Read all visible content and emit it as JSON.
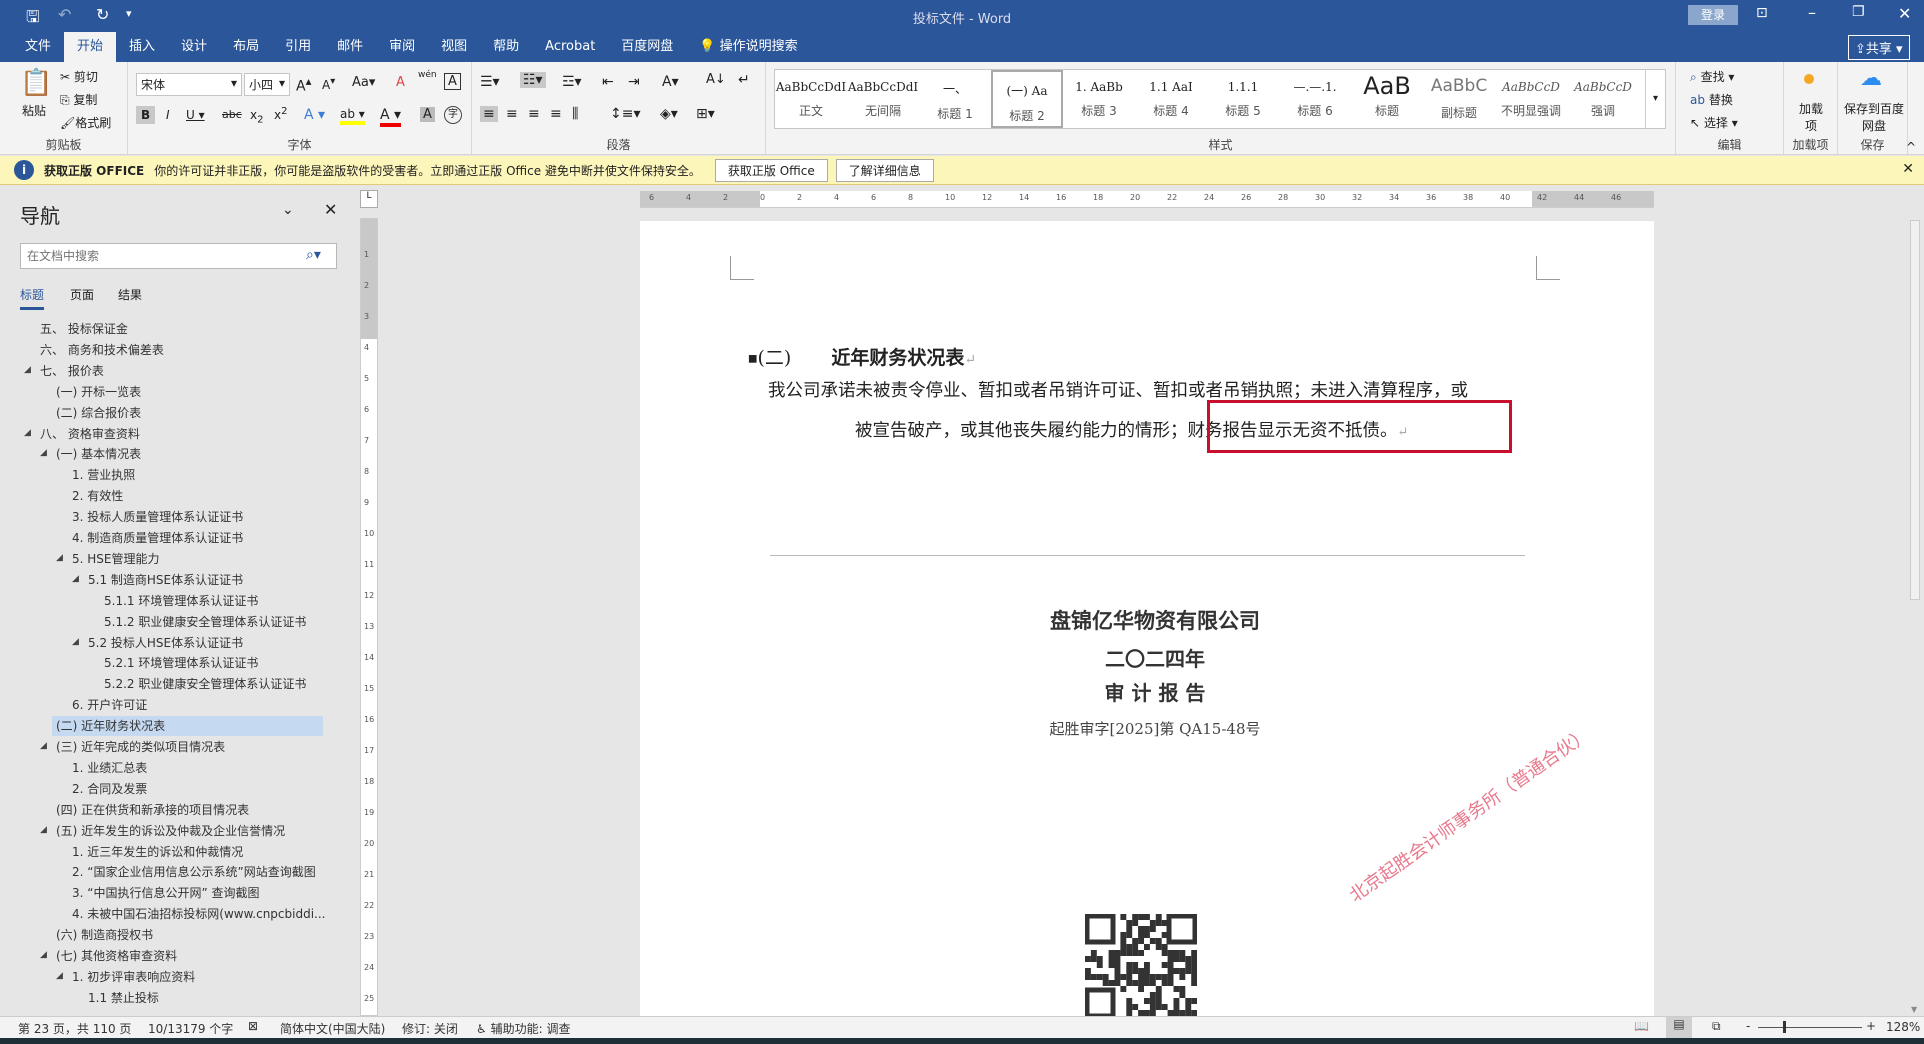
{
  "titlebar": {
    "title": "投标文件 - Word",
    "login": "登录",
    "icons": [
      "save-icon",
      "undo-icon",
      "redo-icon",
      "customize-icon"
    ]
  },
  "tabs": [
    "文件",
    "开始",
    "插入",
    "设计",
    "布局",
    "引用",
    "邮件",
    "审阅",
    "视图",
    "帮助",
    "Acrobat",
    "百度网盘"
  ],
  "tell_me": "操作说明搜索",
  "share": "共享",
  "ribbon": {
    "clipboard": {
      "label": "剪贴板",
      "paste": "粘贴",
      "cut": "剪切",
      "copy": "复制",
      "format_painter": "格式刷"
    },
    "font": {
      "label": "字体",
      "font_name": "宋体",
      "font_size": "小四",
      "change_case": "Aa",
      "pinyin": "wén"
    },
    "paragraph": {
      "label": "段落"
    },
    "styles": {
      "label": "样式",
      "items": [
        {
          "preview": "AaBbCcDdI",
          "name": "正文"
        },
        {
          "preview": "AaBbCcDdI",
          "name": "无间隔"
        },
        {
          "preview": "一、",
          "name": "标题 1"
        },
        {
          "preview": "(一)  Aa",
          "name": "标题 2"
        },
        {
          "preview": "1. AaBb",
          "name": "标题 3"
        },
        {
          "preview": "1.1  AaI",
          "name": "标题 4"
        },
        {
          "preview": "1.1.1",
          "name": "标题 5"
        },
        {
          "preview": "—.—.1.",
          "name": "标题 6"
        },
        {
          "preview": "AaB",
          "name": "标题"
        },
        {
          "preview": "AaBbC",
          "name": "副标题"
        },
        {
          "preview": "AaBbCcD",
          "name": "不明显强调"
        },
        {
          "preview": "AaBbCcD",
          "name": "强调"
        }
      ],
      "selected": "标题 2"
    },
    "editing": {
      "label": "编辑",
      "find": "查找",
      "replace": "替换",
      "select": "选择"
    },
    "addins": {
      "label": "加载项",
      "button": "加载项"
    },
    "save": {
      "label": "保存",
      "button": "保存到百度网盘"
    }
  },
  "message_bar": {
    "title": "获取正版 OFFICE",
    "text": "你的许可证并非正版，你可能是盗版软件的受害者。立即通过正版 Office 避免中断并使文件保持安全。",
    "btn1": "获取正版 Office",
    "btn2": "了解详细信息"
  },
  "nav": {
    "title": "导航",
    "search_placeholder": "在文档中搜索",
    "tabs": [
      "标题",
      "页面",
      "结果"
    ],
    "active_tab": "标题",
    "items": [
      {
        "text": "五、 投标保证金",
        "level": 1,
        "expand": false
      },
      {
        "text": "六、 商务和技术偏差表",
        "level": 1,
        "expand": false
      },
      {
        "text": "七、 报价表",
        "level": 1,
        "expand": true
      },
      {
        "text": "(一) 开标一览表",
        "level": 2,
        "expand": false
      },
      {
        "text": "(二) 综合报价表",
        "level": 2,
        "expand": false
      },
      {
        "text": "八、 资格审查资料",
        "level": 1,
        "expand": true
      },
      {
        "text": "(一) 基本情况表",
        "level": 2,
        "expand": true
      },
      {
        "text": "1. 营业执照",
        "level": 3,
        "expand": false
      },
      {
        "text": "2. 有效性",
        "level": 3,
        "expand": false
      },
      {
        "text": "3. 投标人质量管理体系认证证书",
        "level": 3,
        "expand": false
      },
      {
        "text": "4. 制造商质量管理体系认证证书",
        "level": 3,
        "expand": false
      },
      {
        "text": "5. HSE管理能力",
        "level": 3,
        "expand": true
      },
      {
        "text": "5.1 制造商HSE体系认证证书",
        "level": 4,
        "expand": true
      },
      {
        "text": "5.1.1 环境管理体系认证证书",
        "level": 5,
        "expand": false
      },
      {
        "text": "5.1.2 职业健康安全管理体系认证证书",
        "level": 5,
        "expand": false
      },
      {
        "text": "5.2 投标人HSE体系认证证书",
        "level": 4,
        "expand": true
      },
      {
        "text": "5.2.1 环境管理体系认证证书",
        "level": 5,
        "expand": false
      },
      {
        "text": "5.2.2 职业健康安全管理体系认证证书",
        "level": 5,
        "expand": false
      },
      {
        "text": "6. 开户许可证",
        "level": 3,
        "expand": false
      },
      {
        "text": "(二) 近年财务状况表",
        "level": 2,
        "expand": false,
        "selected": true
      },
      {
        "text": "(三) 近年完成的类似项目情况表",
        "level": 2,
        "expand": true
      },
      {
        "text": "1. 业绩汇总表",
        "level": 3,
        "expand": false
      },
      {
        "text": "2. 合同及发票",
        "level": 3,
        "expand": false
      },
      {
        "text": "(四) 正在供货和新承接的项目情况表",
        "level": 2,
        "expand": false
      },
      {
        "text": "(五) 近年发生的诉讼及仲裁及企业信誉情况",
        "level": 2,
        "expand": true
      },
      {
        "text": "1. 近三年发生的诉讼和仲裁情况",
        "level": 3,
        "expand": false
      },
      {
        "text": "2. “国家企业信用信息公示系统”网站查询截图",
        "level": 3,
        "expand": false
      },
      {
        "text": "3. “中国执行信息公开网” 查询截图",
        "level": 3,
        "expand": false
      },
      {
        "text": "4. 未被中国石油招标投标网(www.cnpcbiddi...",
        "level": 3,
        "expand": false
      },
      {
        "text": "(六) 制造商授权书",
        "level": 2,
        "expand": false
      },
      {
        "text": "(七) 其他资格审查资料",
        "level": 2,
        "expand": true
      },
      {
        "text": "1. 初步评审表响应资料",
        "level": 3,
        "expand": true
      },
      {
        "text": "1.1 禁止投标",
        "level": 4,
        "expand": false
      }
    ]
  },
  "document": {
    "heading_num": "(二)",
    "heading": "近年财务状况表",
    "para_line1": "我公司承诺未被责令停业、暂扣或者吊销许可证、暂扣或者吊销执照；未进入清算程序，或",
    "para_line2a": "被宣告破产，或其他丧失履约能力的情形；",
    "para_line2b": "财务报告显示无资不抵债。",
    "highlight_color": "#c8102e",
    "scan": {
      "company": "盘锦亿华物资有限公司",
      "year": "二〇二四年",
      "report": "审 计 报 告",
      "ref": "起胜审字[2025]第 QA15-48号",
      "stamp": "北京起胜会计师事务所（普通合伙）"
    }
  },
  "status": {
    "page": "第 23 页，共 110 页",
    "words": "10/13179 个字",
    "language": "简体中文(中国大陆)",
    "track": "修订: 关闭",
    "accessibility": "辅助功能: 调查",
    "zoom": "128%",
    "zoom_percent": 128
  }
}
